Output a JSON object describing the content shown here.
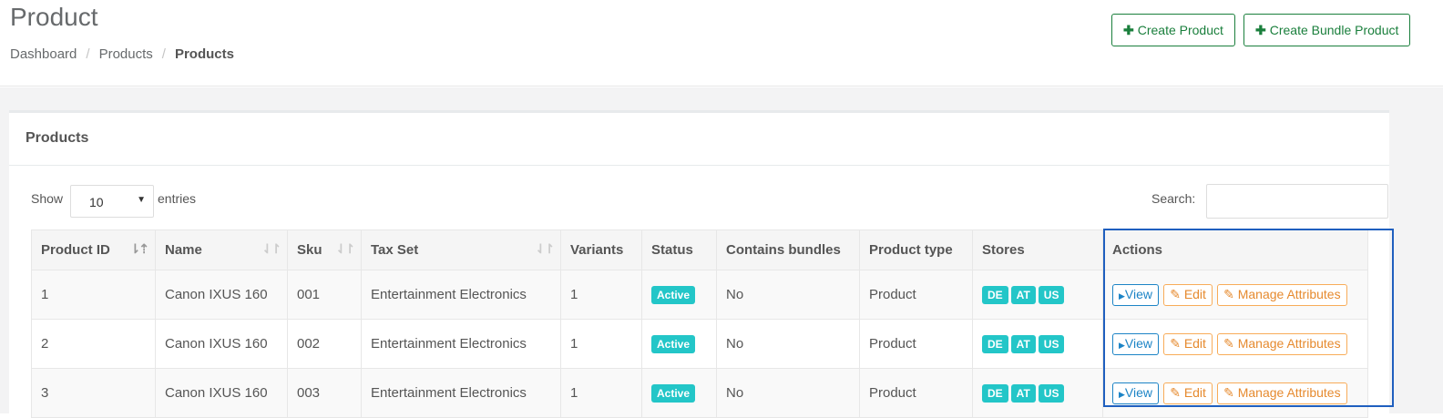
{
  "header": {
    "title": "Product",
    "breadcrumb": [
      "Dashboard",
      "Products",
      "Products"
    ],
    "breadcrumb_sep": "/",
    "create_product": "Create Product",
    "create_bundle": "Create Bundle Product"
  },
  "panel": {
    "title": "Products",
    "show_label": "Show",
    "entries_value": "10",
    "entries_label": "entries",
    "search_label": "Search:"
  },
  "table": {
    "headers": [
      "Product ID",
      "Name",
      "Sku",
      "Tax Set",
      "Variants",
      "Status",
      "Contains bundles",
      "Product type",
      "Stores",
      "Actions"
    ],
    "rows": [
      {
        "id": "1",
        "name": "Canon IXUS 160",
        "sku": "001",
        "tax": "Entertainment Electronics",
        "variants": "1",
        "status": "Active",
        "bundles": "No",
        "type": "Product",
        "stores": [
          "DE",
          "AT",
          "US"
        ],
        "actions": [
          "View",
          "Edit",
          "Manage Attributes"
        ]
      },
      {
        "id": "2",
        "name": "Canon IXUS 160",
        "sku": "002",
        "tax": "Entertainment Electronics",
        "variants": "1",
        "status": "Active",
        "bundles": "No",
        "type": "Product",
        "stores": [
          "DE",
          "AT",
          "US"
        ],
        "actions": [
          "View",
          "Edit",
          "Manage Attributes"
        ]
      },
      {
        "id": "3",
        "name": "Canon IXUS 160",
        "sku": "003",
        "tax": "Entertainment Electronics",
        "variants": "1",
        "status": "Active",
        "bundles": "No",
        "type": "Product",
        "stores": [
          "DE",
          "AT",
          "US"
        ],
        "actions": [
          "View",
          "Edit",
          "Manage Attributes"
        ]
      }
    ]
  },
  "colors": {
    "green": "#1a7f3c",
    "teal_badge": "#23c6c8",
    "view_blue": "#1c84c6",
    "edit_orange": "#f8ac59",
    "highlight": "#1f5fbf"
  }
}
